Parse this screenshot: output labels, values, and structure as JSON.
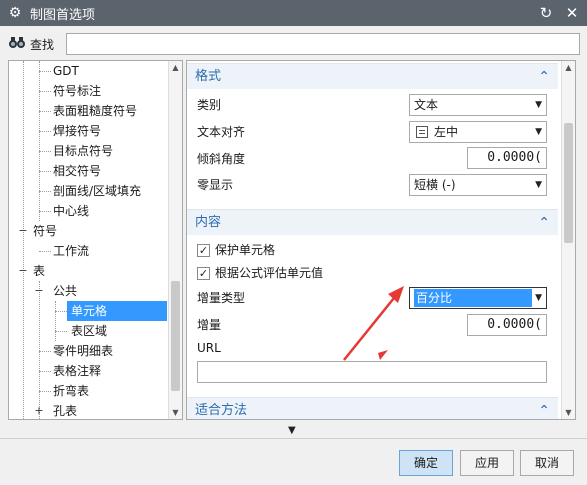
{
  "window": {
    "title": "制图首选项"
  },
  "search": {
    "label": "查找",
    "value": ""
  },
  "tree": {
    "items": [
      {
        "label": "GDT"
      },
      {
        "label": "符号标注"
      },
      {
        "label": "表面粗糙度符号"
      },
      {
        "label": "焊接符号"
      },
      {
        "label": "目标点符号"
      },
      {
        "label": "相交符号"
      },
      {
        "label": "剖面线/区域填充"
      },
      {
        "label": "中心线"
      },
      {
        "label": "符号"
      },
      {
        "label": "工作流"
      },
      {
        "label": "表"
      },
      {
        "label": "公共"
      },
      {
        "label": "单元格",
        "selected": true
      },
      {
        "label": "表区域"
      },
      {
        "label": "零件明细表"
      },
      {
        "label": "表格注释"
      },
      {
        "label": "折弯表"
      },
      {
        "label": "孔表"
      }
    ]
  },
  "format": {
    "header": "格式",
    "category_label": "类别",
    "category_value": "文本",
    "text_align_label": "文本对齐",
    "text_align_value": "左中",
    "slant_label": "倾斜角度",
    "slant_value": "0.0000(",
    "zero_label": "零显示",
    "zero_value": "短横 (-)"
  },
  "content": {
    "header": "内容",
    "protect_label": "保护单元格",
    "protect_checked": true,
    "evaluate_label": "根据公式评估单元值",
    "evaluate_checked": true,
    "increment_type_label": "增量类型",
    "increment_type_value": "百分比",
    "increment_label": "增量",
    "increment_value": "0.0000(",
    "url_label": "URL",
    "url_value": ""
  },
  "fit": {
    "header": "适合方法"
  },
  "buttons": {
    "ok": "确定",
    "apply": "应用",
    "cancel": "取消"
  },
  "colors": {
    "titlebar": "#5b636d",
    "selection": "#3399ff",
    "section_header": "#2b6cb0",
    "annotation_arrow": "#e53935"
  },
  "icons": {
    "title": "gear-icon",
    "reset": "reset-icon",
    "close": "close-icon",
    "find": "binoculars-icon"
  }
}
